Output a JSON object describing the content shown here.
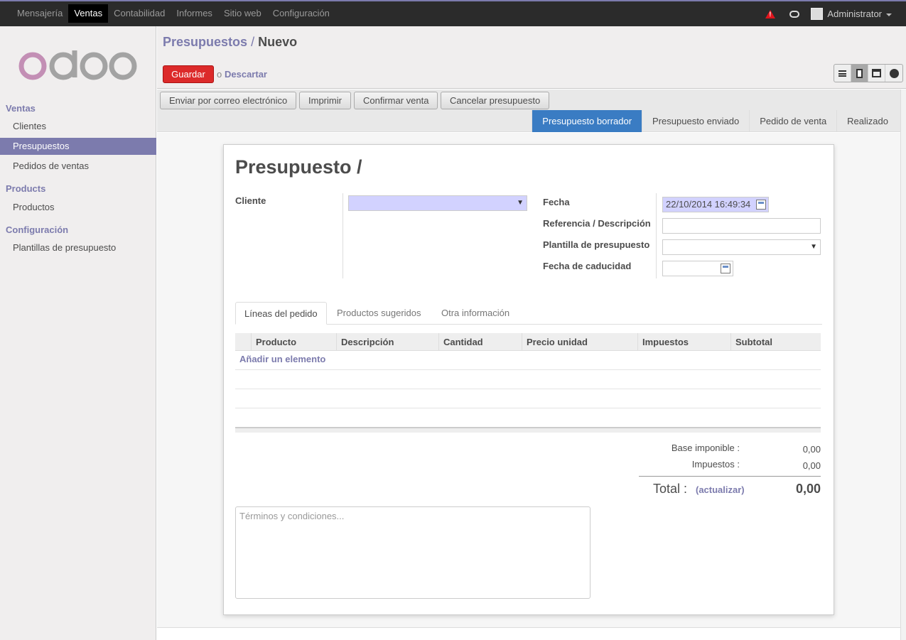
{
  "topbar": {
    "menu": [
      "Mensajería",
      "Ventas",
      "Contabilidad",
      "Informes",
      "Sitio web",
      "Configuración"
    ],
    "active_index": 1,
    "user": "Administrator"
  },
  "sidebar": {
    "logo_text": "odoo",
    "sections": [
      {
        "heading": "Ventas",
        "items": [
          "Clientes",
          "Presupuestos",
          "Pedidos de ventas"
        ]
      },
      {
        "heading": "Products",
        "items": [
          "Productos"
        ]
      },
      {
        "heading": "Configuración",
        "items": [
          "Plantillas de presupuesto"
        ]
      }
    ],
    "active_item": "Presupuestos"
  },
  "header": {
    "breadcrumb_parent": "Presupuestos",
    "breadcrumb_sep": "/",
    "breadcrumb_current": "Nuevo",
    "save_label": "Guardar",
    "or_text": "o",
    "discard_label": "Descartar"
  },
  "actions": {
    "email": "Enviar por correo electrónico",
    "print": "Imprimir",
    "confirm": "Confirmar venta",
    "cancel": "Cancelar presupuesto"
  },
  "statusbar": {
    "steps": [
      "Presupuesto borrador",
      "Presupuesto enviado",
      "Pedido de venta",
      "Realizado"
    ],
    "active_index": 0
  },
  "form": {
    "title": "Presupuesto /",
    "client_label": "Cliente",
    "client_value": "",
    "date_label": "Fecha",
    "date_value": "22/10/2014 16:49:34",
    "ref_label": "Referencia / Descripción",
    "ref_value": "",
    "template_label": "Plantilla de presupuesto",
    "template_value": "",
    "expiry_label": "Fecha de caducidad",
    "expiry_value": ""
  },
  "tabs": [
    "Líneas del pedido",
    "Productos sugeridos",
    "Otra información"
  ],
  "lines": {
    "columns": [
      "Producto",
      "Descripción",
      "Cantidad",
      "Precio unidad",
      "Impuestos",
      "Subtotal"
    ],
    "add_label": "Añadir un elemento"
  },
  "totals": {
    "base_label": "Base imponible :",
    "base_value": "0,00",
    "tax_label": "Impuestos :",
    "tax_value": "0,00",
    "total_label": "Total :",
    "update_label": "(actualizar)",
    "total_value": "0,00"
  },
  "terms_placeholder": "Términos y condiciones...",
  "colors": {
    "brand": "#7c7bad",
    "save": "#dc2a2a",
    "status_active": "#3a7cc3",
    "required_field": "#d2d2ff"
  }
}
